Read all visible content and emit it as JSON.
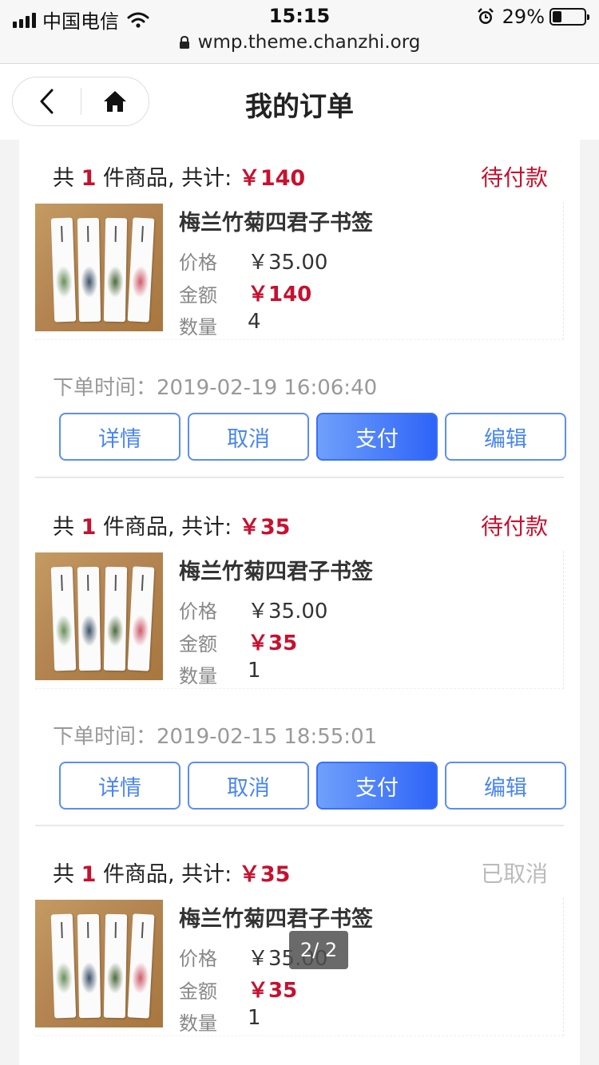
{
  "status_bar": {
    "carrier": "中国电信",
    "time": "15:15",
    "battery": "29%",
    "battery_level": 0.29,
    "url": "wmp.theme.chanzhi.org"
  },
  "header": {
    "title": "我的订单"
  },
  "labels": {
    "price": "价格",
    "amount": "金额",
    "quantity": "数量",
    "order_time": "下单时间：",
    "head_prefix": "共 ",
    "head_mid": " 件商品, 共计: "
  },
  "orders": [
    {
      "count": "1",
      "total": "￥140",
      "status": "待付款",
      "product_name": "梅兰竹菊四君子书签",
      "price": "￥35.00",
      "amount": "￥140",
      "quantity": "4",
      "time": "2019-02-19 16:06:40",
      "buttons": [
        "详情",
        "取消",
        "支付",
        "编辑"
      ]
    },
    {
      "count": "1",
      "total": "￥35",
      "status": "待付款",
      "product_name": "梅兰竹菊四君子书签",
      "price": "￥35.00",
      "amount": "￥35",
      "quantity": "1",
      "time": "2019-02-15 18:55:01",
      "buttons": [
        "详情",
        "取消",
        "支付",
        "编辑"
      ]
    },
    {
      "count": "1",
      "total": "￥35",
      "status": "已取消",
      "product_name": "梅兰竹菊四君子书签",
      "price": "￥35.00",
      "amount": "￥35",
      "quantity": "1"
    }
  ],
  "pager": "2/ 2",
  "colors": {
    "accent_red": "#c8102e",
    "button_blue": "#4a86f0",
    "cancelled_gray": "#bbbbbb"
  }
}
